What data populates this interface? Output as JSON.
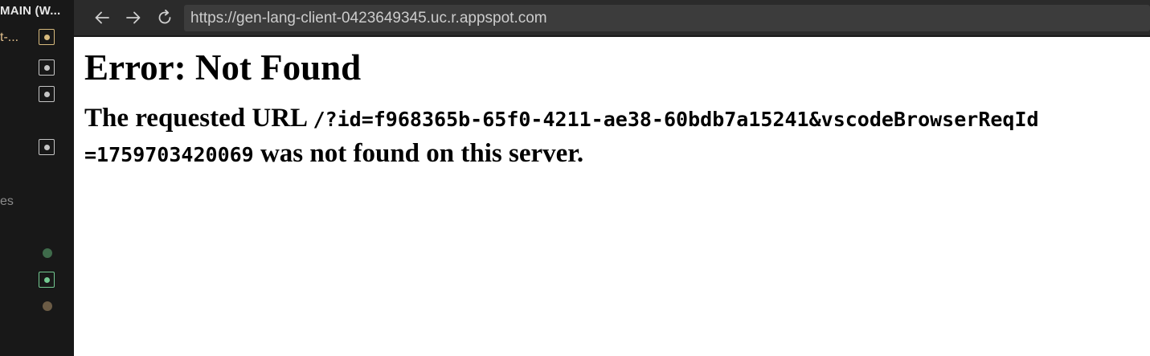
{
  "sidebar": {
    "title": "MAIN (W...",
    "active_item_label": "t-...",
    "partial_label": "es",
    "icons": [
      "open-file-icon",
      "open-file-icon",
      "open-file-icon",
      "open-file-icon",
      "status-dot-icon",
      "open-file-icon",
      "status-dot-icon"
    ],
    "colors": {
      "active": "#d7ba7d",
      "added": "#73c991",
      "muted_green": "#3f6b4b",
      "muted_brown": "#6b5b45"
    }
  },
  "browser": {
    "back_icon": "arrow-left-icon",
    "forward_icon": "arrow-right-icon",
    "reload_icon": "reload-icon",
    "url": "https://gen-lang-client-0423649345.uc.r.appspot.com"
  },
  "page": {
    "heading": "Error: Not Found",
    "message_prefix": "The requested URL ",
    "requested_path": "/?id=f968365b-65f0-4211-ae38-60bdb7a15241&vscodeBrowserReqId=1759703420069",
    "message_suffix": " was not found on this server."
  }
}
